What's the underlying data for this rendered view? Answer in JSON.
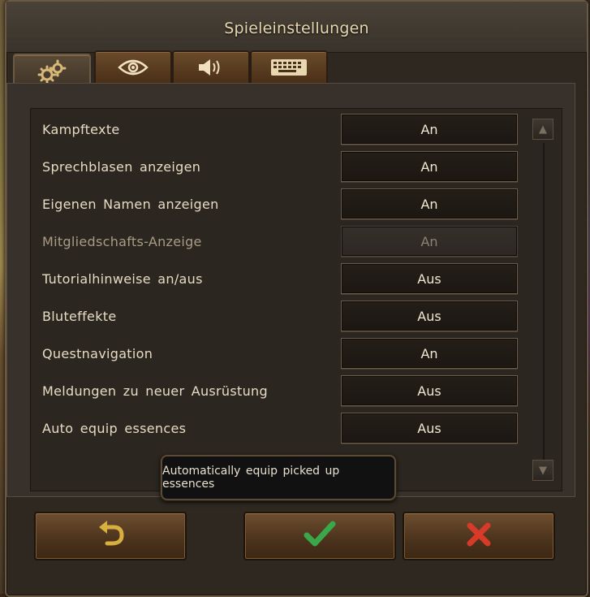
{
  "window": {
    "title": "Spieleinstellungen"
  },
  "tabs": [
    {
      "icon": "gears-icon",
      "active": true
    },
    {
      "icon": "eye-icon",
      "active": false
    },
    {
      "icon": "speaker-icon",
      "active": false
    },
    {
      "icon": "keyboard-icon",
      "active": false
    }
  ],
  "settings": [
    {
      "label": "Kampftexte",
      "value": "An",
      "enabled": true
    },
    {
      "label": "Sprechblasen anzeigen",
      "value": "An",
      "enabled": true
    },
    {
      "label": "Eigenen Namen anzeigen",
      "value": "An",
      "enabled": true
    },
    {
      "label": "Mitgliedschafts-Anzeige",
      "value": "An",
      "enabled": false
    },
    {
      "label": "Tutorialhinweise an/aus",
      "value": "Aus",
      "enabled": true
    },
    {
      "label": "Bluteffekte",
      "value": "Aus",
      "enabled": true
    },
    {
      "label": "Questnavigation",
      "value": "An",
      "enabled": true
    },
    {
      "label": "Meldungen zu neuer Ausrüstung",
      "value": "Aus",
      "enabled": true
    },
    {
      "label": "Auto equip essences",
      "value": "Aus",
      "enabled": true
    }
  ],
  "tooltip": {
    "text": "Automatically equip picked up essences"
  },
  "footer": {
    "reset_icon": "undo-arrow-icon",
    "confirm_icon": "checkmark-icon",
    "cancel_icon": "cross-icon"
  },
  "colors": {
    "checkmark": "#3aa84a",
    "cross": "#d83a2a",
    "undo": "#d8b040"
  }
}
